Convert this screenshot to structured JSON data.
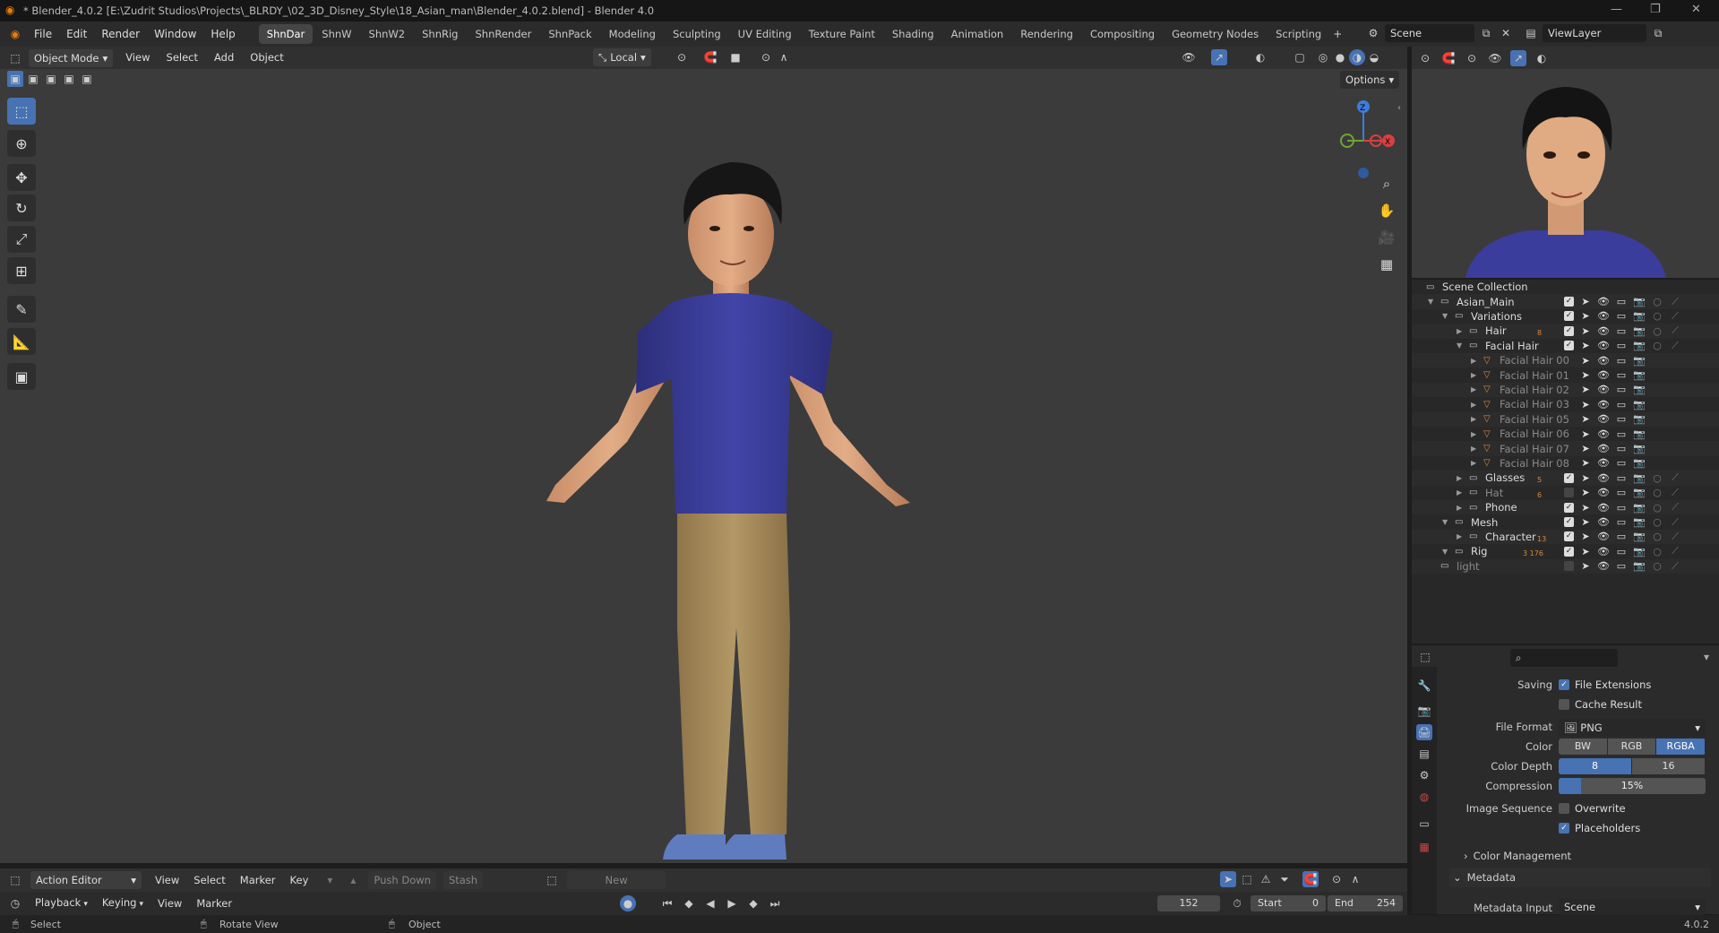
{
  "title": "* Blender_4.0.2 [E:\\Zudrit Studios\\Projects\\_BLRDY_\\02_3D_Disney_Style\\18_Asian_man\\Blender_4.0.2.blend] - Blender 4.0",
  "menu": [
    "File",
    "Edit",
    "Render",
    "Window",
    "Help"
  ],
  "workspaces": [
    "ShnDar",
    "ShnW",
    "ShnW2",
    "ShnRig",
    "ShnRender",
    "ShnPack",
    "Modeling",
    "Sculpting",
    "UV Editing",
    "Texture Paint",
    "Shading",
    "Animation",
    "Rendering",
    "Compositing",
    "Geometry Nodes",
    "Scripting"
  ],
  "active_workspace": "ShnDar",
  "scene": "Scene",
  "view_layer": "ViewLayer",
  "viewport_header": {
    "mode": "Object Mode",
    "menus": [
      "View",
      "Select",
      "Add",
      "Object"
    ],
    "orientation": "Local",
    "options": "Options"
  },
  "gizmo": {
    "z": "Z",
    "x": "X"
  },
  "outliner": {
    "rows": [
      {
        "label": "Scene Collection",
        "indent": 0,
        "dim": false
      },
      {
        "label": "Asian_Main",
        "indent": 1,
        "dim": false
      },
      {
        "label": "Variations",
        "indent": 2,
        "dim": false
      },
      {
        "label": "Hair",
        "indent": 3,
        "dim": false,
        "badge": "8"
      },
      {
        "label": "Facial Hair",
        "indent": 3,
        "dim": false
      },
      {
        "label": "Facial Hair 00",
        "indent": 4,
        "dim": true
      },
      {
        "label": "Facial Hair 01",
        "indent": 4,
        "dim": true
      },
      {
        "label": "Facial Hair 02",
        "indent": 4,
        "dim": true
      },
      {
        "label": "Facial Hair 03",
        "indent": 4,
        "dim": true
      },
      {
        "label": "Facial Hair 05",
        "indent": 4,
        "dim": true
      },
      {
        "label": "Facial Hair 06",
        "indent": 4,
        "dim": true
      },
      {
        "label": "Facial Hair 07",
        "indent": 4,
        "dim": true
      },
      {
        "label": "Facial Hair 08",
        "indent": 4,
        "dim": true
      },
      {
        "label": "Glasses",
        "indent": 3,
        "dim": false,
        "badge": "5"
      },
      {
        "label": "Hat",
        "indent": 3,
        "dim": true,
        "badge": "6"
      },
      {
        "label": "Phone",
        "indent": 3,
        "dim": false
      },
      {
        "label": "Mesh",
        "indent": 2,
        "dim": false
      },
      {
        "label": "Character",
        "indent": 3,
        "dim": false,
        "badge": "13"
      },
      {
        "label": "Rig",
        "indent": 2,
        "dim": false,
        "badge": "3 176"
      },
      {
        "label": "light",
        "indent": 1,
        "dim": true
      }
    ]
  },
  "properties": {
    "saving_label": "Saving",
    "file_extensions": "File Extensions",
    "cache_result": "Cache Result",
    "file_format_label": "File Format",
    "file_format": "PNG",
    "color_label": "Color",
    "color_options": [
      "BW",
      "RGB",
      "RGBA"
    ],
    "color_selected": "RGBA",
    "color_depth_label": "Color Depth",
    "color_depth_options": [
      "8",
      "16"
    ],
    "color_depth_selected": "8",
    "compression_label": "Compression",
    "compression": "15%",
    "compression_value": 0.15,
    "image_sequence_label": "Image Sequence",
    "overwrite": "Overwrite",
    "placeholders": "Placeholders",
    "color_management": "Color Management",
    "metadata": "Metadata",
    "metadata_input_label": "Metadata Input",
    "metadata_input": "Scene"
  },
  "action_editor": {
    "mode": "Action Editor",
    "menus": [
      "View",
      "Select",
      "Marker",
      "Key"
    ],
    "push_down": "Push Down",
    "stash": "Stash",
    "new": "New"
  },
  "timeline": {
    "menus": [
      "Playback",
      "Keying",
      "View",
      "Marker"
    ],
    "frame": "152",
    "start_label": "Start",
    "start": "0",
    "end_label": "End",
    "end": "254"
  },
  "status": {
    "select": "Select",
    "rotate": "Rotate View",
    "object": "Object",
    "version": "4.0.2"
  },
  "colors": {
    "accent": "#4772b3",
    "shirt": "#3b3d9c",
    "pants": "#a58a5c",
    "skin": "#d9a27a"
  }
}
